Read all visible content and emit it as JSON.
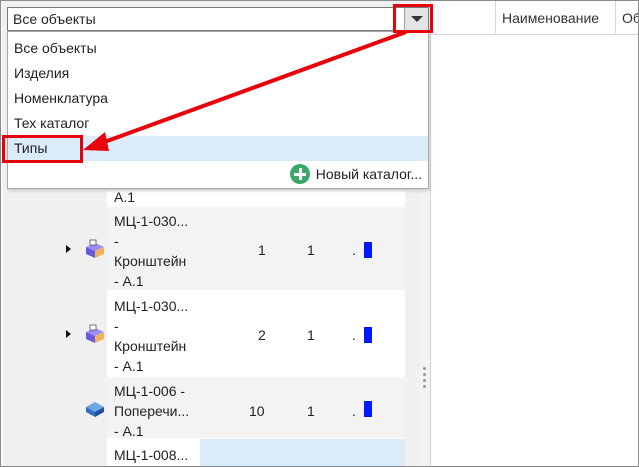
{
  "dropdown": {
    "selected": "Все объекты",
    "options": [
      "Все объекты",
      "Изделия",
      "Номенклатура",
      "Тех каталог",
      "Типы"
    ],
    "new_catalog_label": "Новый каталог..."
  },
  "columns": {
    "name": "Наименование",
    "next": "Об"
  },
  "tree": {
    "partial_top": "А.1",
    "rows": [
      {
        "name": "МЦ-1-030...\n-\nКронштейн\n- А.1",
        "qty": "1",
        "n": "1",
        "dot": "."
      },
      {
        "name": "МЦ-1-030...\n-\nКронштейн\n- А.1",
        "qty": "2",
        "n": "1",
        "dot": "."
      },
      {
        "name": "МЦ-1-006 -\nПоперечи...\n- А.1",
        "qty": "10",
        "n": "1",
        "dot": "."
      },
      {
        "name": "МЦ-1-008...",
        "qty": "",
        "n": "",
        "dot": ""
      }
    ]
  },
  "colors": {
    "highlight": "#e8000a",
    "selection": "#dcebf8",
    "bar": "#0019ff",
    "plus": "#3aa869"
  }
}
